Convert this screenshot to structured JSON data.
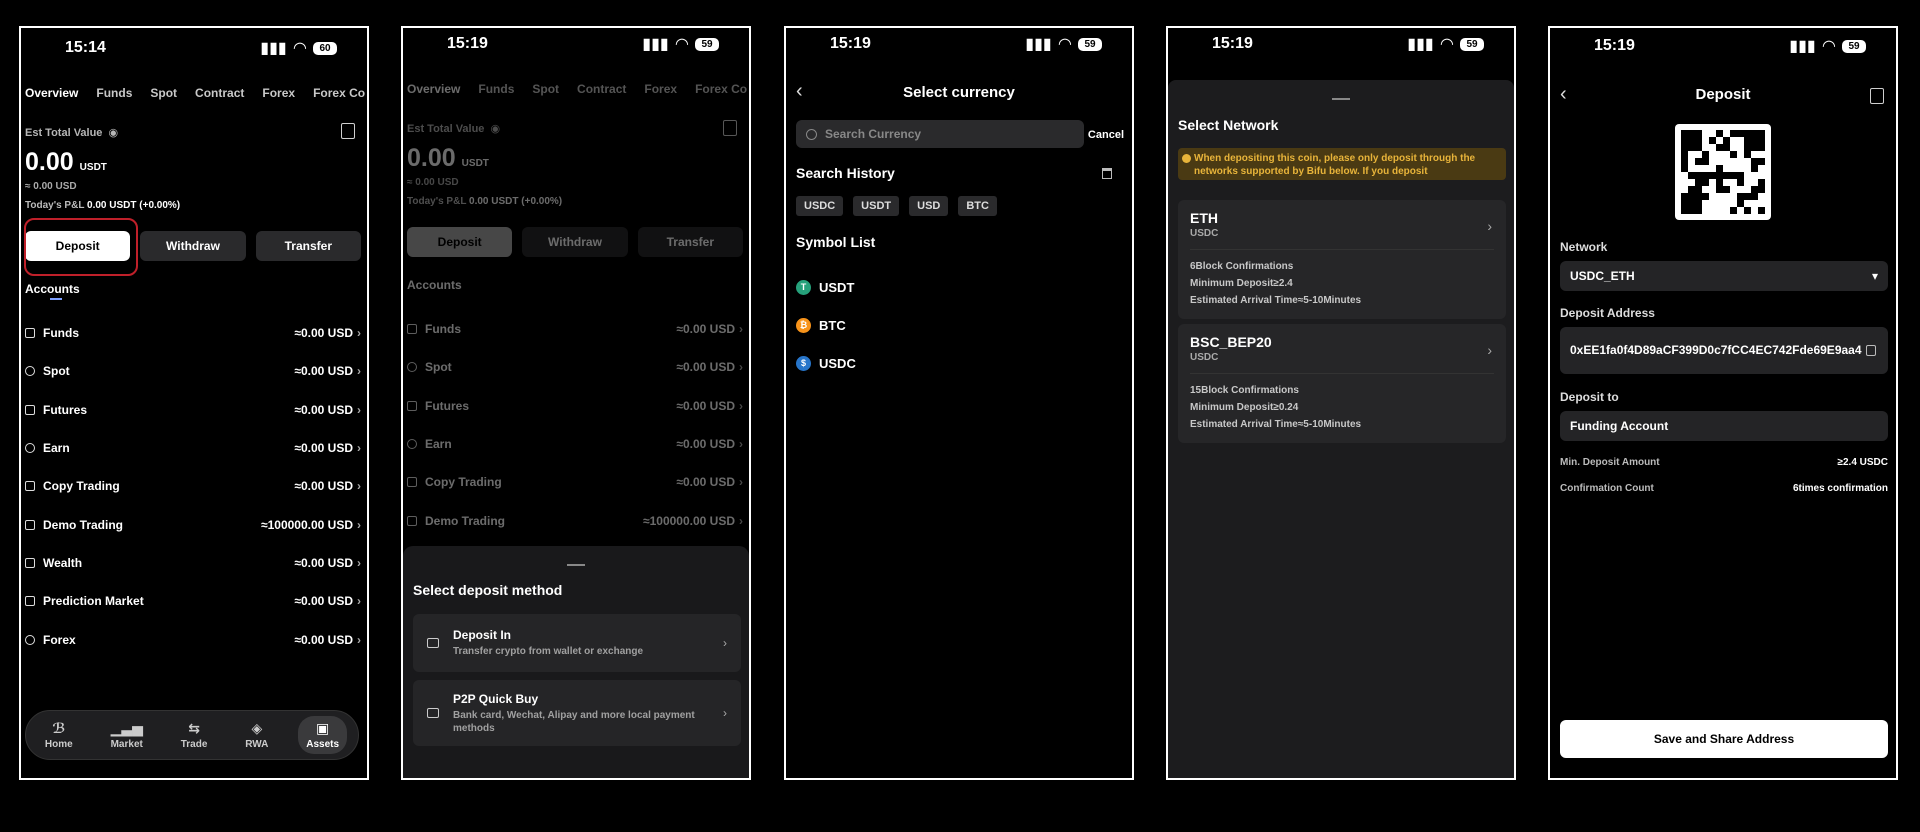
{
  "screens": [
    {
      "status": {
        "time": "15:14",
        "battery": "60"
      },
      "tabs": [
        "Overview",
        "Funds",
        "Spot",
        "Contract",
        "Forex",
        "Forex Co"
      ],
      "est_label": "Est Total Value",
      "total_value": "0.00",
      "total_unit": "USDT",
      "approx": "≈ 0.00 USD",
      "pnl_label": "Today's P&L",
      "pnl_value": "0.00 USDT (+0.00%)",
      "buttons": {
        "deposit": "Deposit",
        "withdraw": "Withdraw",
        "transfer": "Transfer"
      },
      "accounts_title": "Accounts",
      "accounts": [
        {
          "name": "Funds",
          "value": "≈0.00 USD"
        },
        {
          "name": "Spot",
          "value": "≈0.00 USD"
        },
        {
          "name": "Futures",
          "value": "≈0.00 USD"
        },
        {
          "name": "Earn",
          "value": "≈0.00 USD"
        },
        {
          "name": "Copy Trading",
          "value": "≈0.00 USD"
        },
        {
          "name": "Demo Trading",
          "value": "≈100000.00 USD"
        },
        {
          "name": "Wealth",
          "value": "≈0.00 USD"
        },
        {
          "name": "Prediction Market",
          "value": "≈0.00 USD"
        },
        {
          "name": "Forex",
          "value": "≈0.00 USD"
        }
      ],
      "nav": [
        "Home",
        "Market",
        "Trade",
        "RWA",
        "Assets"
      ]
    },
    {
      "status": {
        "time": "15:19",
        "battery": "59"
      },
      "tabs": [
        "Overview",
        "Funds",
        "Spot",
        "Contract",
        "Forex",
        "Forex Co"
      ],
      "est_label": "Est Total Value",
      "total_value": "0.00",
      "total_unit": "USDT",
      "approx": "≈ 0.00 USD",
      "pnl_label": "Today's P&L",
      "pnl_value": "0.00 USDT (+0.00%)",
      "buttons": {
        "deposit": "Deposit",
        "withdraw": "Withdraw",
        "transfer": "Transfer"
      },
      "accounts_title": "Accounts",
      "accounts": [
        {
          "name": "Funds",
          "value": "≈0.00 USD"
        },
        {
          "name": "Spot",
          "value": "≈0.00 USD"
        },
        {
          "name": "Futures",
          "value": "≈0.00 USD"
        },
        {
          "name": "Earn",
          "value": "≈0.00 USD"
        },
        {
          "name": "Copy Trading",
          "value": "≈0.00 USD"
        },
        {
          "name": "Demo Trading",
          "value": "≈100000.00 USD"
        }
      ],
      "sheet": {
        "title": "Select deposit method",
        "options": [
          {
            "title": "Deposit In",
            "desc": "Transfer crypto from wallet or exchange"
          },
          {
            "title": "P2P Quick Buy",
            "desc": "Bank card, Wechat, Alipay and more local payment methods"
          }
        ]
      }
    },
    {
      "status": {
        "time": "15:19",
        "battery": "59"
      },
      "title": "Select currency",
      "search_placeholder": "Search Currency",
      "cancel": "Cancel",
      "history_title": "Search History",
      "history": [
        "USDC",
        "USDT",
        "USD",
        "BTC"
      ],
      "symbol_title": "Symbol List",
      "symbols": [
        {
          "name": "USDT",
          "glyph": "T",
          "color": "#26a17b"
        },
        {
          "name": "BTC",
          "glyph": "₿",
          "color": "#f7931a"
        },
        {
          "name": "USDC",
          "glyph": "$",
          "color": "#2775ca"
        }
      ]
    },
    {
      "status": {
        "time": "15:19",
        "battery": "59"
      },
      "title": "Select Network",
      "warning": "When depositing this coin, please only deposit through the networks supported by Bifu below. If you deposit",
      "networks": [
        {
          "name": "ETH",
          "token": "USDC",
          "lines": [
            "6Block Confirmations",
            "Minimum Deposit≥2.4",
            "Estimated Arrival Time≈5-10Minutes"
          ]
        },
        {
          "name": "BSC_BEP20",
          "token": "USDC",
          "lines": [
            "15Block Confirmations",
            "Minimum Deposit≥0.24",
            "Estimated Arrival Time≈5-10Minutes"
          ]
        }
      ]
    },
    {
      "status": {
        "time": "15:19",
        "battery": "59"
      },
      "title": "Deposit",
      "network_label": "Network",
      "network_value": "USDC_ETH",
      "address_label": "Deposit Address",
      "address_value": "0xEE1fa0f4D89aCF399D0c7fCC4EC742Fde69E9aa4",
      "deposit_to_label": "Deposit to",
      "deposit_to_value": "Funding Account",
      "min_label": "Min. Deposit Amount",
      "min_value": "≥2.4 USDC",
      "conf_label": "Confirmation Count",
      "conf_value": "6times confirmation",
      "save_button": "Save and Share Address"
    }
  ]
}
